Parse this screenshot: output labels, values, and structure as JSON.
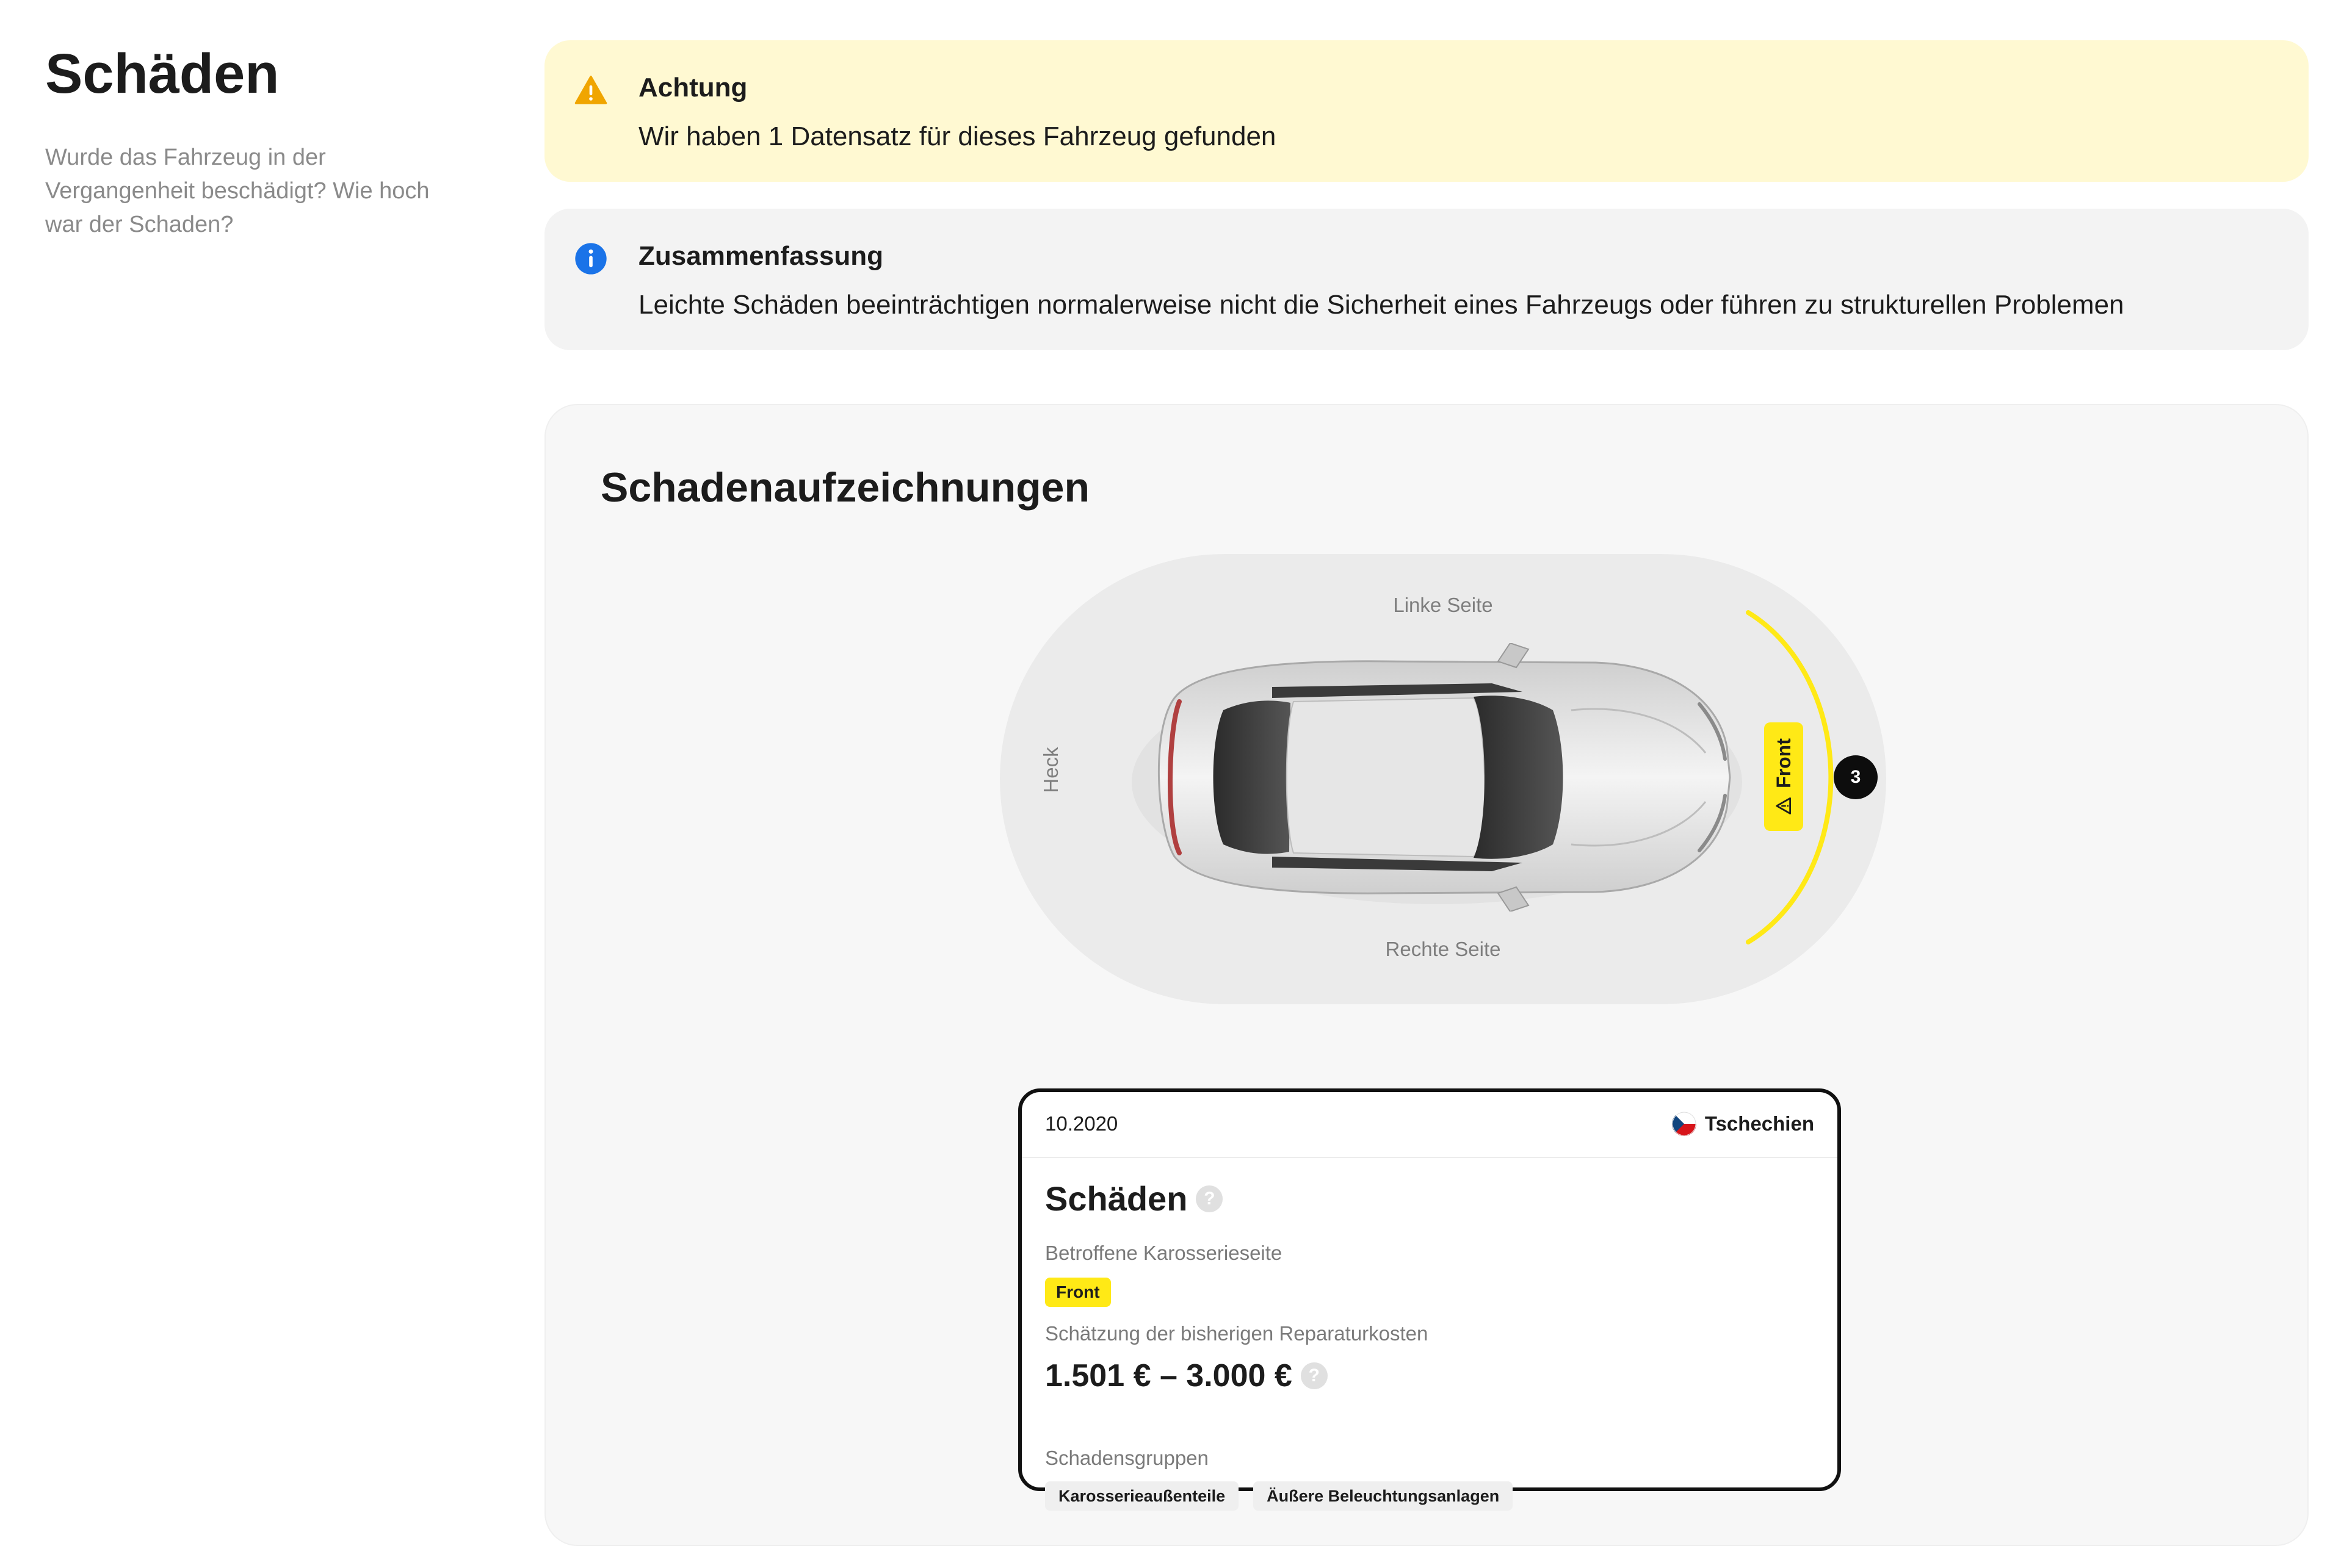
{
  "section": {
    "title": "Schäden",
    "subtitle": "Wurde das Fahrzeug in der Vergangenheit beschädigt? Wie hoch war der Schaden?"
  },
  "notices": {
    "warning": {
      "title": "Achtung",
      "text": "Wir haben 1 Datensatz für dieses Fahrzeug gefunden",
      "icon": "warning-icon",
      "color": "#fff9d2",
      "icon_color": "#f0a500"
    },
    "info": {
      "title": "Zusammenfassung",
      "text": "Leichte Schäden beeinträchtigen normalerweise nicht die Sicherheit eines Fahrzeugs oder führen zu strukturellen Problemen",
      "icon": "info-icon",
      "color": "#f3f3f3",
      "icon_color": "#1a73e8"
    }
  },
  "records": {
    "title": "Schadenaufzeichnungen",
    "diagram": {
      "label_left_side": "Linke Seite",
      "label_right_side": "Rechte Seite",
      "label_rear": "Heck",
      "front_badge": "Front",
      "damage_count": "3",
      "highlight_color": "#ffe916"
    },
    "record": {
      "date": "10.2020",
      "country": "Tschechien",
      "title": "Schäden",
      "affected_side_label": "Betroffene Karosserieseite",
      "affected_side": "Front",
      "cost_label": "Schätzung der bisherigen Reparaturkosten",
      "cost_value": "1.501 € – 3.000 €",
      "groups_label": "Schadensgruppen",
      "groups": [
        "Karosserieaußenteile",
        "Äußere Beleuchtungsanlagen"
      ],
      "help_symbol": "?"
    }
  }
}
